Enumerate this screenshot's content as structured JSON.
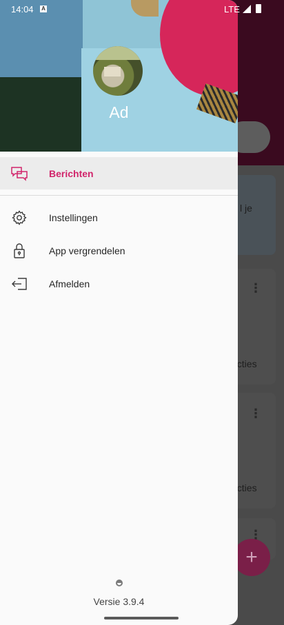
{
  "status_bar": {
    "time": "14:04",
    "notification_icon": "A",
    "network": "LTE"
  },
  "drawer": {
    "username": "Ad",
    "menu": [
      {
        "label": "Berichten",
        "icon": "chat-icon",
        "active": true
      },
      {
        "label": "Instellingen",
        "icon": "gear-icon",
        "active": false
      },
      {
        "label": "App vergrendelen",
        "icon": "lock-icon",
        "active": false
      },
      {
        "label": "Afmelden",
        "icon": "logout-icon",
        "active": false
      }
    ],
    "version": "Versie 3.9.4"
  },
  "background": {
    "partial_text_1": "l je",
    "partial_text_2": "acties",
    "partial_text_3": "acties",
    "fab_symbol": "+"
  },
  "colors": {
    "accent": "#d1256b",
    "header_bg": "#3a0a1f"
  }
}
